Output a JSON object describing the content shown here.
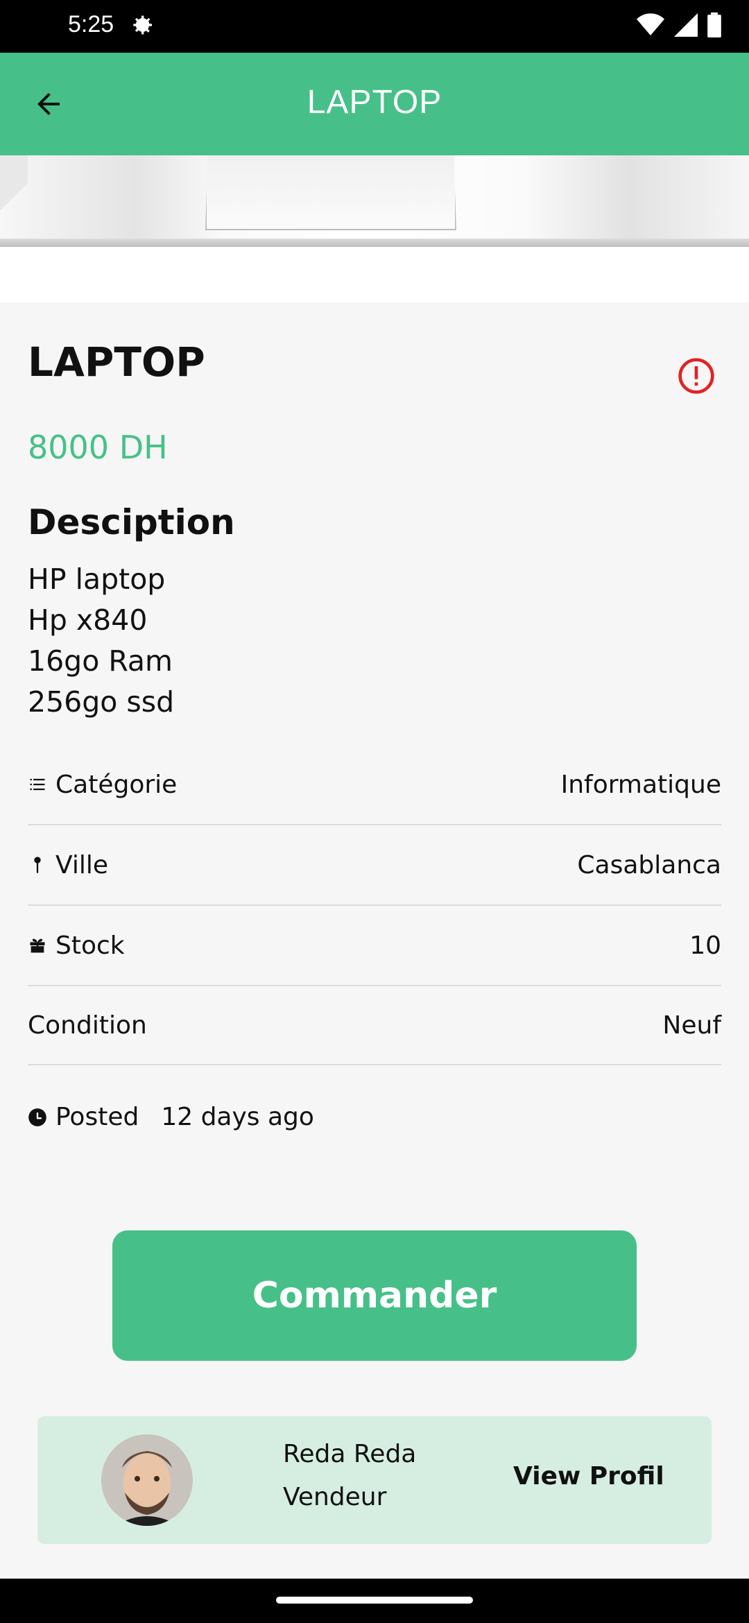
{
  "status": {
    "time": "5:25"
  },
  "app_bar": {
    "title": "LAPTOP"
  },
  "product": {
    "title": "LAPTOP",
    "price": "8000 DH",
    "description_title": "Desciption",
    "description_lines": [
      "HP laptop",
      "Hp x840",
      "16go Ram",
      "256go ssd"
    ]
  },
  "details": [
    {
      "label": "Catégorie",
      "value": "Informatique",
      "icon": "list-icon"
    },
    {
      "label": "Ville",
      "value": "Casablanca",
      "icon": "pin-icon"
    },
    {
      "label": "Stock",
      "value": "10",
      "icon": "box-icon"
    },
    {
      "label": "Condition",
      "value": "Neuf",
      "icon": ""
    }
  ],
  "posted": {
    "label": "Posted",
    "value": "12 days ago"
  },
  "order_button": {
    "label": "Commander"
  },
  "seller": {
    "name": "Reda Reda",
    "role": "Vendeur",
    "view_label": "View Profil"
  },
  "colors": {
    "accent": "#46c088",
    "alert": "#e02424",
    "card_bg": "#d6eee2"
  }
}
